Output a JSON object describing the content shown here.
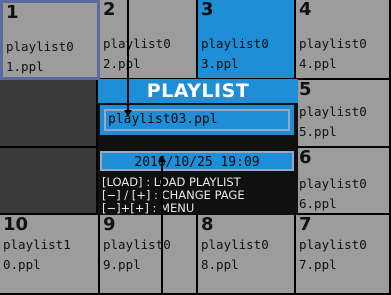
{
  "tiles": [
    {
      "num": "1",
      "name": "playlist0\n1.ppl"
    },
    {
      "num": "2",
      "name": "playlist0\n2.ppl"
    },
    {
      "num": "3",
      "name": "playlist0\n3.ppl"
    },
    {
      "num": "4",
      "name": "playlist0\n4.ppl"
    },
    {
      "num": "5",
      "name": "playlist0\n5.ppl"
    },
    {
      "num": "6",
      "name": "playlist0\n6.ppl"
    },
    {
      "num": "7",
      "name": "playlist0\n7.ppl"
    },
    {
      "num": "8",
      "name": "playlist0\n8.ppl"
    },
    {
      "num": "9",
      "name": "playlist0\n9.ppl"
    },
    {
      "num": "10",
      "name": "playlist1\n0.ppl"
    }
  ],
  "panel": {
    "title": "PLAYLIST",
    "filename": "playlist03.ppl",
    "datetime": "2016/10/25 19:09",
    "help": [
      "[LOAD] : LOAD PLAYLIST",
      "[−] / [+] : CHANGE PAGE",
      "[−]+[+] : MENU"
    ]
  },
  "colors": {
    "tile": "#9c9c9c",
    "selected": "#1e8fd6",
    "empty": "#3a3a3a",
    "focus_border": "#5b6a9e"
  }
}
